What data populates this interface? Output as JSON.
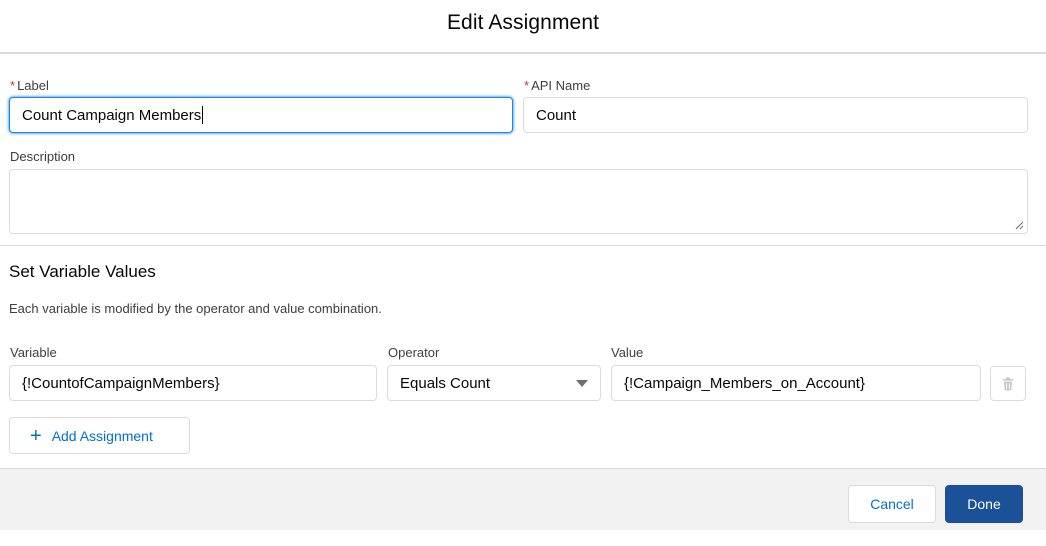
{
  "modal": {
    "title": "Edit Assignment"
  },
  "label_field": {
    "label": "Label",
    "value": "Count Campaign Members",
    "required_mark": "*"
  },
  "api_name_field": {
    "label": "API Name",
    "value": "Count",
    "required_mark": "*"
  },
  "description_field": {
    "label": "Description",
    "value": ""
  },
  "variables_section": {
    "title": "Set Variable Values",
    "help_text": "Each variable is modified by the operator and value combination.",
    "headers": {
      "variable": "Variable",
      "operator": "Operator",
      "value": "Value"
    },
    "row": {
      "variable": "{!CountofCampaignMembers}",
      "operator": "Equals Count",
      "value": "{!Campaign_Members_on_Account}"
    },
    "add_label": "Add Assignment"
  },
  "footer": {
    "cancel_label": "Cancel",
    "done_label": "Done"
  },
  "colors": {
    "brand": "#1b5297",
    "link": "#0070d2",
    "focus_border": "#1589ee",
    "required": "#c23934",
    "footer_bg": "#f3f2f2"
  },
  "icons": {
    "delete": "trash-icon",
    "add": "plus-icon",
    "select": "chevron-down-icon",
    "resize": "resize-grip-icon"
  }
}
